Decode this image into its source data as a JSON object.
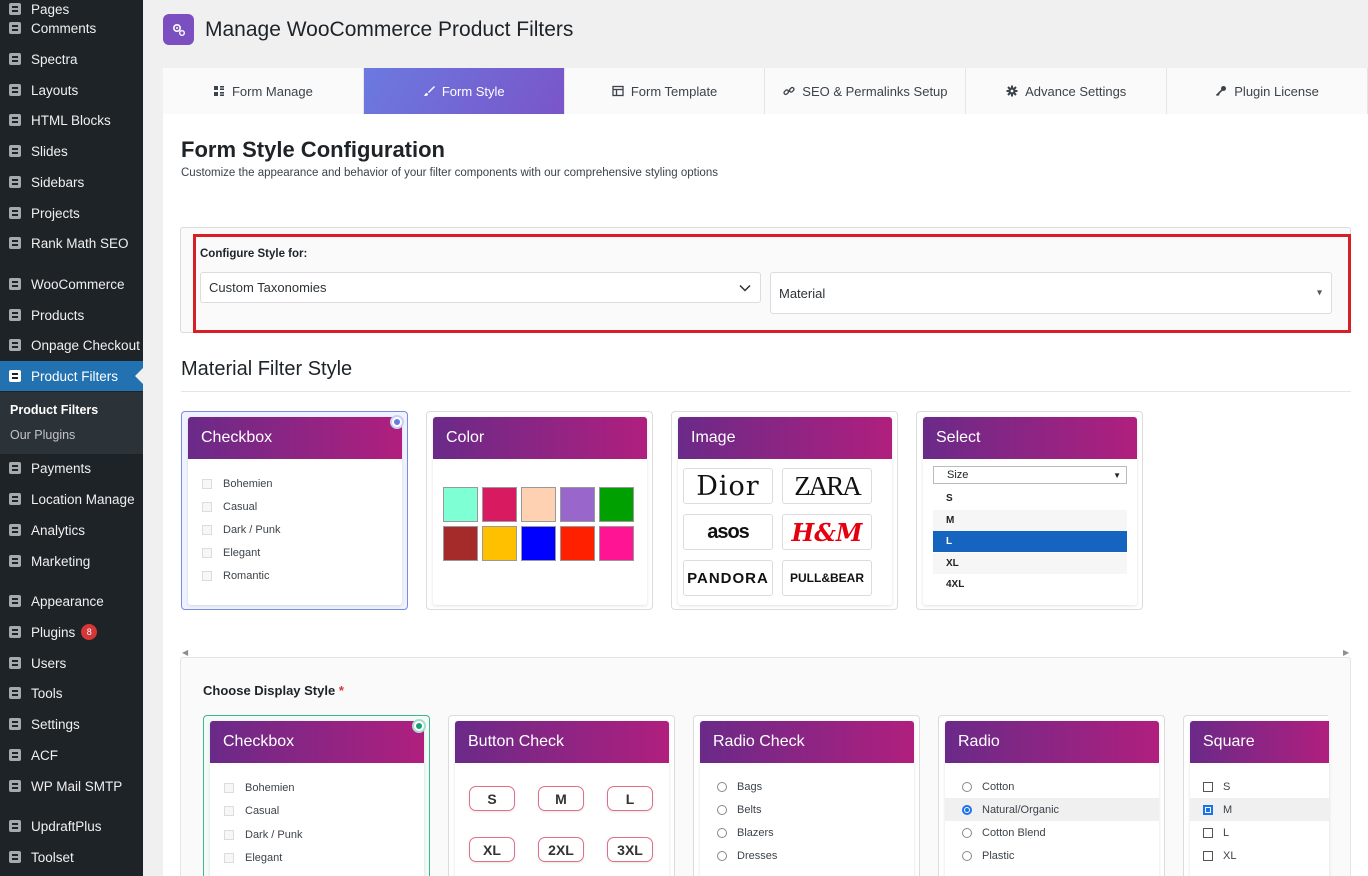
{
  "sidebar": {
    "items": [
      {
        "label": "Pages",
        "icon": "pages-icon"
      },
      {
        "label": "Comments",
        "icon": "comments-icon"
      },
      {
        "label": "Spectra",
        "icon": "spectra-icon"
      },
      {
        "label": "Layouts",
        "icon": "layouts-icon"
      },
      {
        "label": "HTML Blocks",
        "icon": "html-blocks-icon"
      },
      {
        "label": "Slides",
        "icon": "slides-icon"
      },
      {
        "label": "Sidebars",
        "icon": "sidebars-icon"
      },
      {
        "label": "Projects",
        "icon": "projects-icon"
      },
      {
        "label": "Rank Math SEO",
        "icon": "rank-math-icon"
      },
      {
        "label": "WooCommerce",
        "icon": "woocommerce-icon"
      },
      {
        "label": "Products",
        "icon": "products-icon"
      },
      {
        "label": "Onpage Checkout",
        "icon": "cart-icon"
      },
      {
        "label": "Product Filters",
        "icon": "filter-icon"
      },
      {
        "label": "Payments",
        "icon": "payments-icon"
      },
      {
        "label": "Location Manage",
        "icon": "location-icon"
      },
      {
        "label": "Analytics",
        "icon": "analytics-icon"
      },
      {
        "label": "Marketing",
        "icon": "marketing-icon"
      },
      {
        "label": "Appearance",
        "icon": "appearance-icon"
      },
      {
        "label": "Plugins",
        "icon": "plugins-icon",
        "badge": "8"
      },
      {
        "label": "Users",
        "icon": "users-icon"
      },
      {
        "label": "Tools",
        "icon": "tools-icon"
      },
      {
        "label": "Settings",
        "icon": "settings-icon"
      },
      {
        "label": "ACF",
        "icon": "acf-icon"
      },
      {
        "label": "WP Mail SMTP",
        "icon": "mail-icon"
      },
      {
        "label": "UpdraftPlus",
        "icon": "updraft-icon"
      },
      {
        "label": "Toolset",
        "icon": "toolset-icon"
      }
    ],
    "submenu": [
      "Product Filters",
      "Our Plugins"
    ]
  },
  "header": {
    "title": "Manage WooCommerce Product Filters"
  },
  "tabs": [
    {
      "label": "Form Manage",
      "icon": "form-manage-icon"
    },
    {
      "label": "Form Style",
      "icon": "brush-icon",
      "active": true
    },
    {
      "label": "Form Template",
      "icon": "template-icon"
    },
    {
      "label": "SEO & Permalinks Setup",
      "icon": "link-icon"
    },
    {
      "label": "Advance Settings",
      "icon": "gear-icon"
    },
    {
      "label": "Plugin License",
      "icon": "key-icon"
    }
  ],
  "main": {
    "title": "Form Style Configuration",
    "subtitle": "Customize the appearance and behavior of your filter components with our comprehensive styling options",
    "config_label": "Configure Style for:",
    "taxonomy_select": "Custom Taxonomies",
    "term_select": "Material",
    "filter_heading": "Material Filter Style",
    "display_label": "Choose Display Style",
    "required_mark": "*"
  },
  "style_cards": {
    "checkbox": {
      "title": "Checkbox",
      "items": [
        "Bohemien",
        "Casual",
        "Dark / Punk",
        "Elegant",
        "Romantic"
      ]
    },
    "color": {
      "title": "Color",
      "swatches": [
        "#7fffd4",
        "#d81b60",
        "#ffd1b3",
        "#9966cc",
        "#00a000",
        "#a52a2a",
        "#ffc000",
        "#0000ff",
        "#ff2000",
        "#ff1493"
      ]
    },
    "image": {
      "title": "Image",
      "logos": [
        "Dior",
        "ZARA",
        "asos",
        "H&M",
        "PANDORA",
        "PULL&BEAR"
      ]
    },
    "select": {
      "title": "Select",
      "placeholder": "Size",
      "options": [
        "S",
        "M",
        "L",
        "XL",
        "4XL"
      ],
      "highlighted": "L"
    }
  },
  "display_cards": {
    "checkbox": {
      "title": "Checkbox",
      "items": [
        "Bohemien",
        "Casual",
        "Dark / Punk",
        "Elegant"
      ]
    },
    "button_check": {
      "title": "Button Check",
      "buttons": [
        "S",
        "M",
        "L",
        "XL",
        "2XL",
        "3XL"
      ]
    },
    "radio_check": {
      "title": "Radio Check",
      "items": [
        "Bags",
        "Belts",
        "Blazers",
        "Dresses"
      ]
    },
    "radio": {
      "title": "Radio",
      "items": [
        "Cotton",
        "Natural/Organic",
        "Cotton Blend",
        "Plastic"
      ],
      "selected": "Natural/Organic"
    },
    "square": {
      "title": "Square",
      "items": [
        "S",
        "M",
        "L",
        "XL"
      ],
      "selected": "M"
    }
  },
  "colors": {
    "accent": "#2271b1",
    "highlight_border": "#d61f26",
    "card_gradient_start": "#6a2a88",
    "card_gradient_end": "#b01f7e"
  }
}
